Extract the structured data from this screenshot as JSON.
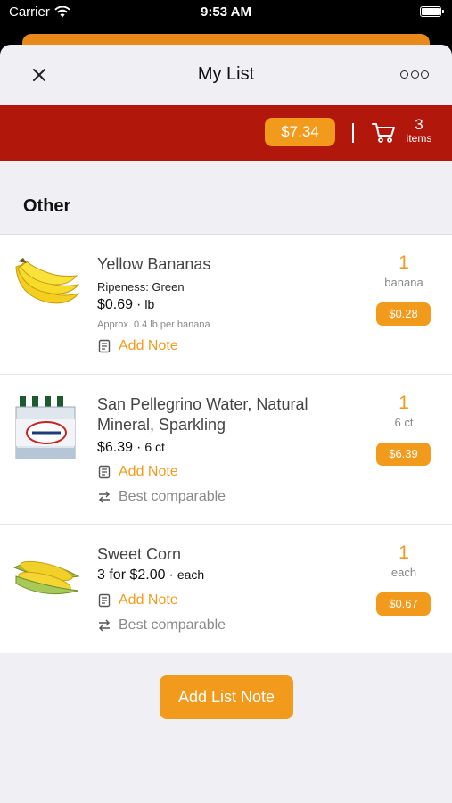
{
  "status_bar": {
    "carrier": "Carrier",
    "time": "9:53 AM"
  },
  "nav": {
    "title": "My List"
  },
  "cart": {
    "total": "$7.34",
    "count": "3",
    "count_label": "items"
  },
  "section": {
    "title": "Other"
  },
  "items": [
    {
      "name": "Yellow Bananas",
      "ripeness": "Ripeness: Green",
      "price": "$0.69",
      "unit": "lb",
      "approx": "Approx. 0.4 lb per banana",
      "note_label": "Add Note",
      "qty": "1",
      "qty_unit": "banana",
      "line_price": "$0.28",
      "image": "banana-image"
    },
    {
      "name": "San Pellegrino Water, Natural Mineral, Sparkling",
      "price": "$6.39",
      "unit": "6 ct",
      "note_label": "Add Note",
      "comparable_label": "Best comparable",
      "qty": "1",
      "qty_unit": "6 ct",
      "line_price": "$6.39",
      "image": "water-bottles-image"
    },
    {
      "name": "Sweet Corn",
      "price": "3 for $2.00",
      "unit": "each",
      "note_label": "Add Note",
      "comparable_label": "Best comparable",
      "qty": "1",
      "qty_unit": "each",
      "line_price": "$0.67",
      "image": "corn-image"
    }
  ],
  "footer": {
    "add_list_note": "Add List Note"
  },
  "colors": {
    "accent": "#f29a1c",
    "bar_red": "#b1170b",
    "peek_orange": "#e8891a"
  }
}
